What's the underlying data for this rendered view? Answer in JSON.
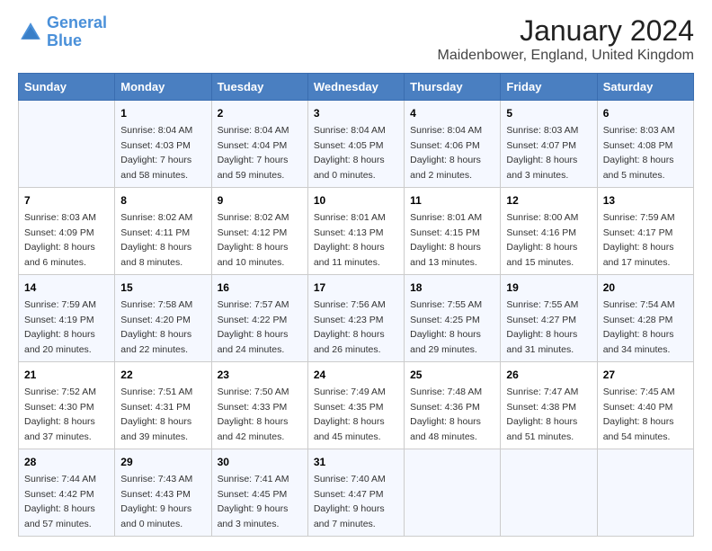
{
  "header": {
    "logo_line1": "General",
    "logo_line2": "Blue",
    "title": "January 2024",
    "subtitle": "Maidenbower, England, United Kingdom"
  },
  "weekdays": [
    "Sunday",
    "Monday",
    "Tuesday",
    "Wednesday",
    "Thursday",
    "Friday",
    "Saturday"
  ],
  "weeks": [
    [
      {
        "day": "",
        "sunrise": "",
        "sunset": "",
        "daylight": ""
      },
      {
        "day": "1",
        "sunrise": "Sunrise: 8:04 AM",
        "sunset": "Sunset: 4:03 PM",
        "daylight": "Daylight: 7 hours and 58 minutes."
      },
      {
        "day": "2",
        "sunrise": "Sunrise: 8:04 AM",
        "sunset": "Sunset: 4:04 PM",
        "daylight": "Daylight: 7 hours and 59 minutes."
      },
      {
        "day": "3",
        "sunrise": "Sunrise: 8:04 AM",
        "sunset": "Sunset: 4:05 PM",
        "daylight": "Daylight: 8 hours and 0 minutes."
      },
      {
        "day": "4",
        "sunrise": "Sunrise: 8:04 AM",
        "sunset": "Sunset: 4:06 PM",
        "daylight": "Daylight: 8 hours and 2 minutes."
      },
      {
        "day": "5",
        "sunrise": "Sunrise: 8:03 AM",
        "sunset": "Sunset: 4:07 PM",
        "daylight": "Daylight: 8 hours and 3 minutes."
      },
      {
        "day": "6",
        "sunrise": "Sunrise: 8:03 AM",
        "sunset": "Sunset: 4:08 PM",
        "daylight": "Daylight: 8 hours and 5 minutes."
      }
    ],
    [
      {
        "day": "7",
        "sunrise": "Sunrise: 8:03 AM",
        "sunset": "Sunset: 4:09 PM",
        "daylight": "Daylight: 8 hours and 6 minutes."
      },
      {
        "day": "8",
        "sunrise": "Sunrise: 8:02 AM",
        "sunset": "Sunset: 4:11 PM",
        "daylight": "Daylight: 8 hours and 8 minutes."
      },
      {
        "day": "9",
        "sunrise": "Sunrise: 8:02 AM",
        "sunset": "Sunset: 4:12 PM",
        "daylight": "Daylight: 8 hours and 10 minutes."
      },
      {
        "day": "10",
        "sunrise": "Sunrise: 8:01 AM",
        "sunset": "Sunset: 4:13 PM",
        "daylight": "Daylight: 8 hours and 11 minutes."
      },
      {
        "day": "11",
        "sunrise": "Sunrise: 8:01 AM",
        "sunset": "Sunset: 4:15 PM",
        "daylight": "Daylight: 8 hours and 13 minutes."
      },
      {
        "day": "12",
        "sunrise": "Sunrise: 8:00 AM",
        "sunset": "Sunset: 4:16 PM",
        "daylight": "Daylight: 8 hours and 15 minutes."
      },
      {
        "day": "13",
        "sunrise": "Sunrise: 7:59 AM",
        "sunset": "Sunset: 4:17 PM",
        "daylight": "Daylight: 8 hours and 17 minutes."
      }
    ],
    [
      {
        "day": "14",
        "sunrise": "Sunrise: 7:59 AM",
        "sunset": "Sunset: 4:19 PM",
        "daylight": "Daylight: 8 hours and 20 minutes."
      },
      {
        "day": "15",
        "sunrise": "Sunrise: 7:58 AM",
        "sunset": "Sunset: 4:20 PM",
        "daylight": "Daylight: 8 hours and 22 minutes."
      },
      {
        "day": "16",
        "sunrise": "Sunrise: 7:57 AM",
        "sunset": "Sunset: 4:22 PM",
        "daylight": "Daylight: 8 hours and 24 minutes."
      },
      {
        "day": "17",
        "sunrise": "Sunrise: 7:56 AM",
        "sunset": "Sunset: 4:23 PM",
        "daylight": "Daylight: 8 hours and 26 minutes."
      },
      {
        "day": "18",
        "sunrise": "Sunrise: 7:55 AM",
        "sunset": "Sunset: 4:25 PM",
        "daylight": "Daylight: 8 hours and 29 minutes."
      },
      {
        "day": "19",
        "sunrise": "Sunrise: 7:55 AM",
        "sunset": "Sunset: 4:27 PM",
        "daylight": "Daylight: 8 hours and 31 minutes."
      },
      {
        "day": "20",
        "sunrise": "Sunrise: 7:54 AM",
        "sunset": "Sunset: 4:28 PM",
        "daylight": "Daylight: 8 hours and 34 minutes."
      }
    ],
    [
      {
        "day": "21",
        "sunrise": "Sunrise: 7:52 AM",
        "sunset": "Sunset: 4:30 PM",
        "daylight": "Daylight: 8 hours and 37 minutes."
      },
      {
        "day": "22",
        "sunrise": "Sunrise: 7:51 AM",
        "sunset": "Sunset: 4:31 PM",
        "daylight": "Daylight: 8 hours and 39 minutes."
      },
      {
        "day": "23",
        "sunrise": "Sunrise: 7:50 AM",
        "sunset": "Sunset: 4:33 PM",
        "daylight": "Daylight: 8 hours and 42 minutes."
      },
      {
        "day": "24",
        "sunrise": "Sunrise: 7:49 AM",
        "sunset": "Sunset: 4:35 PM",
        "daylight": "Daylight: 8 hours and 45 minutes."
      },
      {
        "day": "25",
        "sunrise": "Sunrise: 7:48 AM",
        "sunset": "Sunset: 4:36 PM",
        "daylight": "Daylight: 8 hours and 48 minutes."
      },
      {
        "day": "26",
        "sunrise": "Sunrise: 7:47 AM",
        "sunset": "Sunset: 4:38 PM",
        "daylight": "Daylight: 8 hours and 51 minutes."
      },
      {
        "day": "27",
        "sunrise": "Sunrise: 7:45 AM",
        "sunset": "Sunset: 4:40 PM",
        "daylight": "Daylight: 8 hours and 54 minutes."
      }
    ],
    [
      {
        "day": "28",
        "sunrise": "Sunrise: 7:44 AM",
        "sunset": "Sunset: 4:42 PM",
        "daylight": "Daylight: 8 hours and 57 minutes."
      },
      {
        "day": "29",
        "sunrise": "Sunrise: 7:43 AM",
        "sunset": "Sunset: 4:43 PM",
        "daylight": "Daylight: 9 hours and 0 minutes."
      },
      {
        "day": "30",
        "sunrise": "Sunrise: 7:41 AM",
        "sunset": "Sunset: 4:45 PM",
        "daylight": "Daylight: 9 hours and 3 minutes."
      },
      {
        "day": "31",
        "sunrise": "Sunrise: 7:40 AM",
        "sunset": "Sunset: 4:47 PM",
        "daylight": "Daylight: 9 hours and 7 minutes."
      },
      {
        "day": "",
        "sunrise": "",
        "sunset": "",
        "daylight": ""
      },
      {
        "day": "",
        "sunrise": "",
        "sunset": "",
        "daylight": ""
      },
      {
        "day": "",
        "sunrise": "",
        "sunset": "",
        "daylight": ""
      }
    ]
  ]
}
